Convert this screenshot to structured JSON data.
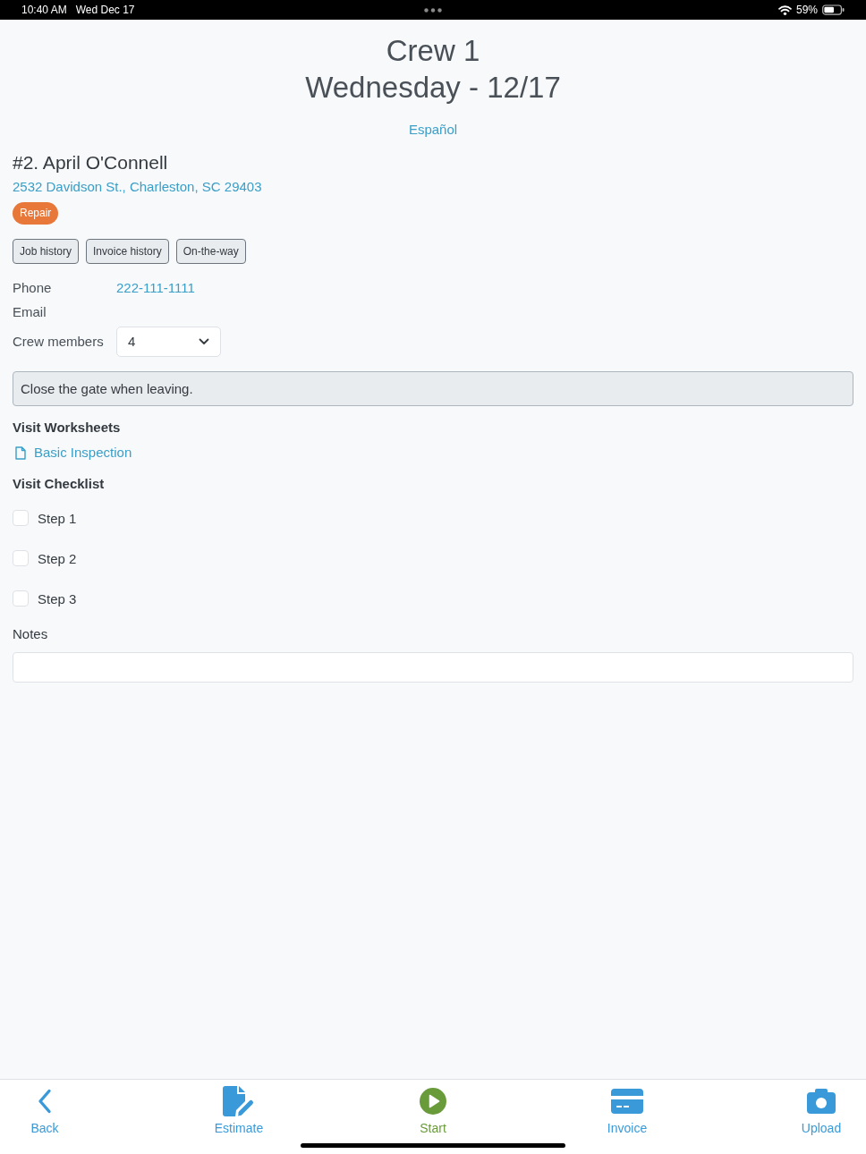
{
  "status_bar": {
    "time": "10:40 AM",
    "date": "Wed Dec 17",
    "battery": "59%"
  },
  "header": {
    "title": "Crew 1",
    "subtitle": "Wednesday - 12/17",
    "language_link": "Español"
  },
  "customer": {
    "name": "#2. April O'Connell",
    "address": "2532 Davidson St., Charleston, SC 29403",
    "tag": "Repair"
  },
  "actions": [
    "Job history",
    "Invoice history",
    "On-the-way"
  ],
  "details": [
    {
      "kind": "link",
      "label": "Phone",
      "value": "222-111-1111"
    },
    {
      "kind": "text",
      "label": "Email"
    },
    {
      "kind": "select",
      "label": "Crew members",
      "value": "4"
    }
  ],
  "instructions": "Close the gate when leaving.",
  "worksheets": {
    "heading": "Visit Worksheets",
    "items": [
      "Basic Inspection"
    ]
  },
  "checklist": {
    "heading": "Visit Checklist",
    "items": [
      {
        "label": "Step 1",
        "checked": false
      },
      {
        "label": "Step 2",
        "checked": false
      },
      {
        "label": "Step 3",
        "checked": false
      }
    ]
  },
  "notes": {
    "label": "Notes"
  },
  "tab_bar": [
    {
      "kind": "back",
      "label": "Back",
      "color": "#3a9ad9"
    },
    {
      "kind": "estimate",
      "label": "Estimate",
      "color": "#3a9ad9"
    },
    {
      "kind": "start",
      "label": "Start",
      "color": "#6a9b3b"
    },
    {
      "kind": "invoice",
      "label": "Invoice",
      "color": "#3a9ad9"
    },
    {
      "kind": "upload",
      "label": "Upload",
      "color": "#3a9ad9"
    }
  ]
}
